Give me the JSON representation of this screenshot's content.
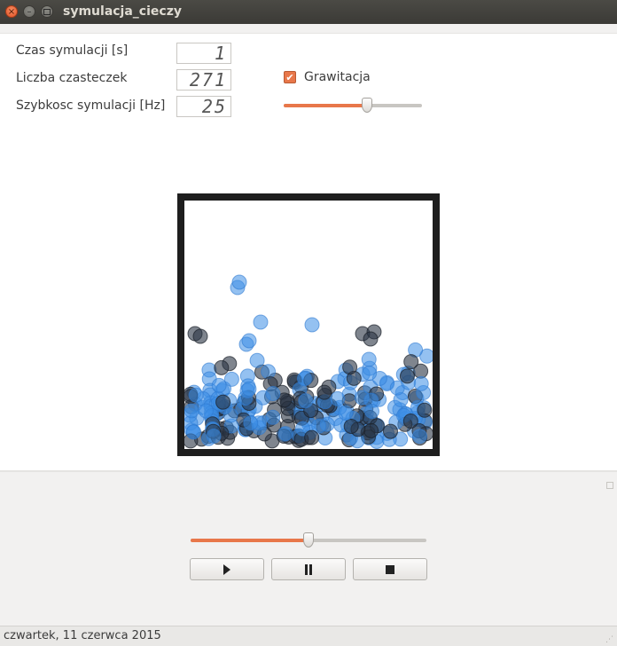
{
  "window": {
    "title": "symulacja_cieczy"
  },
  "controls": {
    "sim_time_label": "Czas symulacji [s]",
    "sim_time_value": "1",
    "particle_count_label": "Liczba czasteczek",
    "particle_count_value": "271",
    "sim_speed_label": "Szybkosc symulacji [Hz]",
    "sim_speed_value": "25",
    "gravity_label": "Grawitacja",
    "gravity_checked": true,
    "gravity_slider_fraction": 0.6
  },
  "playback": {
    "position_fraction": 0.5,
    "play_icon": "play-icon",
    "pause_icon": "pause-icon",
    "stop_icon": "stop-icon"
  },
  "status": {
    "date_text": "czwartek, 11 czerwca 2015"
  },
  "colors": {
    "accent": "#e8774a",
    "particle_blue": "#3d8ee6",
    "particle_dark": "#2a3342"
  }
}
